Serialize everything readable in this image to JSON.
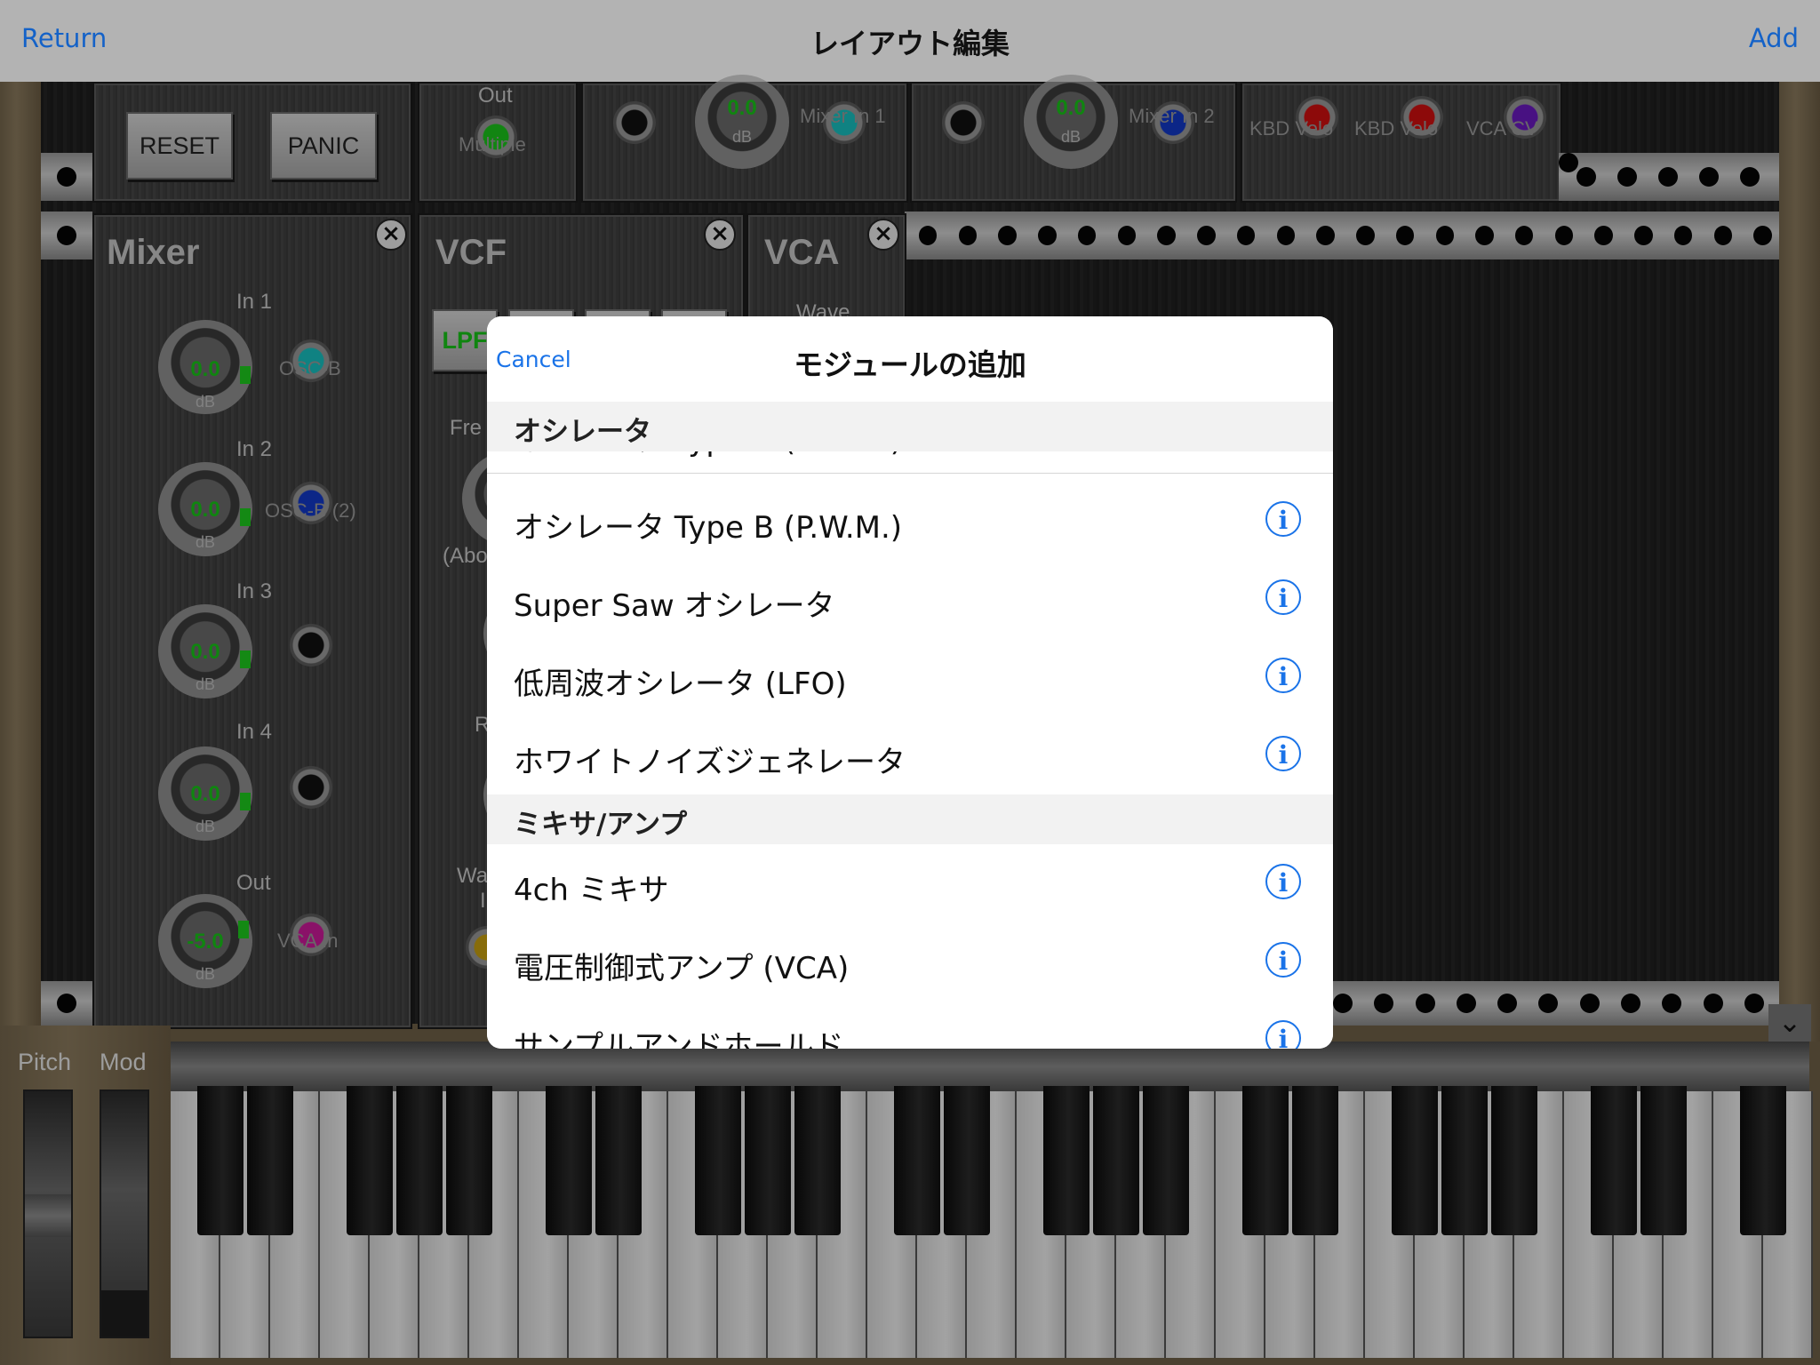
{
  "navbar": {
    "return_label": "Return",
    "title": "レイアウト編集",
    "add_label": "Add"
  },
  "rack": {
    "reset_label": "RESET",
    "panic_label": "PANIC",
    "multiple": {
      "out_label": "Out",
      "name": "Multiple"
    },
    "mixer_in1_strip": {
      "value": "0.0",
      "unit": "dB",
      "label": "Mixer In 1"
    },
    "mixer_in2_strip": {
      "value": "0.0",
      "unit": "dB",
      "label": "Mixer In 2"
    },
    "cv_labels": [
      "KBD Velo",
      "KBD Velo",
      "VCA CV"
    ],
    "mixer": {
      "title": "Mixer",
      "channels": [
        {
          "label": "In 1",
          "value": "0.0",
          "unit": "dB",
          "jack_label": "OSC-B"
        },
        {
          "label": "In 2",
          "value": "0.0",
          "unit": "dB",
          "jack_label": "OSC-B (2)"
        },
        {
          "label": "In 3",
          "value": "0.0",
          "unit": "dB",
          "jack_label": ""
        },
        {
          "label": "In 4",
          "value": "0.0",
          "unit": "dB",
          "jack_label": ""
        },
        {
          "label": "Out",
          "value": "-5.0",
          "unit": "dB",
          "jack_label": "VCA In"
        }
      ]
    },
    "vcf": {
      "title": "VCF",
      "filter_label": "LPF",
      "freq_label": "Fre",
      "abs_label": "(Abo",
      "r_label": "R",
      "wa_label": "Wa",
      "i_label": "I"
    },
    "vca": {
      "title": "VCA",
      "wave_label": "Wave"
    }
  },
  "keyboard": {
    "pitch_label": "Pitch",
    "mod_label": "Mod",
    "collapse_icon": "chevron-down-icon"
  },
  "modal": {
    "cancel_label": "Cancel",
    "title": "モジュールの追加",
    "sections": [
      {
        "header": "オシレータ",
        "items": [
          {
            "label": "オシレータ Type A (P.W.M.)"
          },
          {
            "label": "オシレータ Type B (P.W.M.)"
          },
          {
            "label": "Super Saw オシレータ"
          },
          {
            "label": "低周波オシレータ (LFO)"
          },
          {
            "label": "ホワイトノイズジェネレータ"
          }
        ]
      },
      {
        "header": "ミキサ/アンプ",
        "items": [
          {
            "label": "4ch ミキサ"
          },
          {
            "label": "電圧制御式アンプ (VCA)"
          },
          {
            "label": "サンプルアンドホールド"
          }
        ]
      }
    ],
    "info_glyph": "i"
  },
  "colors": {
    "accent": "#1a73e8",
    "navbar_bg": "#b3b3b3",
    "led_green": "#1ecb1e"
  }
}
